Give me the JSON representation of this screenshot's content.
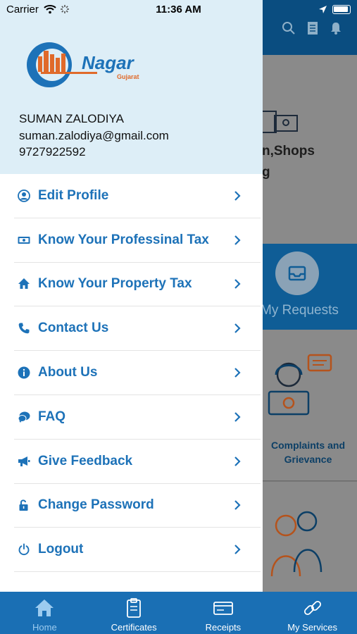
{
  "status_bar": {
    "carrier": "Carrier",
    "time": "11:36 AM"
  },
  "background": {
    "card1_text_line1": "n,Shops",
    "card1_text_line2": "g",
    "requests_label": "My Requests",
    "complaints_line1": "Complaints and",
    "complaints_line2": "Grievance"
  },
  "drawer": {
    "logo_text": "Nagar",
    "logo_subtext": "Gujarat",
    "user": {
      "name": "SUMAN ZALODIYA",
      "email": "suman.zalodiya@gmail.com",
      "phone": "9727922592"
    },
    "menu": [
      {
        "label": "Edit Profile",
        "icon": "user-circle-icon"
      },
      {
        "label": "Know Your Professinal Tax",
        "icon": "money-icon"
      },
      {
        "label": "Know Your Property Tax",
        "icon": "home-icon"
      },
      {
        "label": "Contact Us",
        "icon": "phone-icon"
      },
      {
        "label": "About Us",
        "icon": "info-icon"
      },
      {
        "label": "FAQ",
        "icon": "chat-icon"
      },
      {
        "label": "Give Feedback",
        "icon": "megaphone-icon"
      },
      {
        "label": "Change Password",
        "icon": "unlock-icon"
      },
      {
        "label": "Logout",
        "icon": "power-icon"
      }
    ]
  },
  "tab_bar": {
    "tabs": [
      {
        "label": "Home",
        "icon": "home-icon",
        "active": true
      },
      {
        "label": "Certificates",
        "icon": "clipboard-icon",
        "active": false
      },
      {
        "label": "Receipts",
        "icon": "receipt-icon",
        "active": false
      },
      {
        "label": "My Services",
        "icon": "link-icon",
        "active": false
      }
    ]
  },
  "colors": {
    "accent": "#1d72b8",
    "header_bg": "#ddeef7",
    "tab_bar": "#1a6fb4"
  }
}
